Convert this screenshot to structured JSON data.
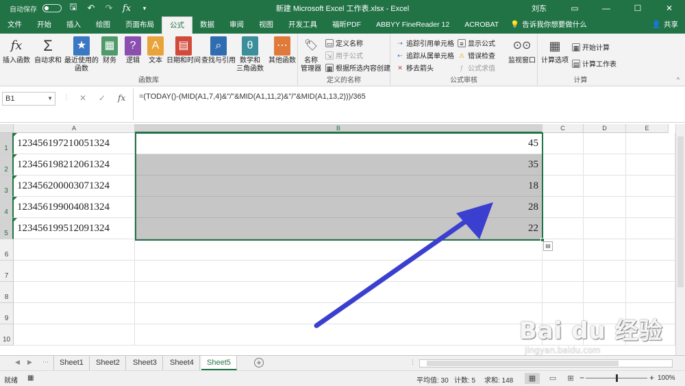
{
  "titlebar": {
    "autosave_label": "自动保存",
    "autosave_state": "关",
    "title": "新建 Microsoft Excel 工作表.xlsx  -  Excel",
    "user": "刘东",
    "min": "—",
    "max": "☐",
    "close": "✕"
  },
  "tabs": [
    "文件",
    "开始",
    "插入",
    "绘图",
    "页面布局",
    "公式",
    "数据",
    "审阅",
    "视图",
    "开发工具",
    "福昕PDF",
    "ABBYY FineReader 12",
    "ACROBAT"
  ],
  "active_tab": "公式",
  "tell_me": "告诉我你想要做什么",
  "share": "共享",
  "ribbon": {
    "function_library": {
      "label": "函数库",
      "buttons": [
        "插入函数",
        "自动求和",
        "最近使用的\n函数",
        "财务",
        "逻辑",
        "文本",
        "日期和时间",
        "查找与引用",
        "数学和\n三角函数",
        "其他函数"
      ]
    },
    "defined_names": {
      "label": "定义的名称",
      "manager": "名称\n管理器",
      "items": [
        "定义名称",
        "用于公式",
        "根据所选内容创建"
      ]
    },
    "formula_auditing": {
      "label": "公式审核",
      "items": [
        "追踪引用单元格",
        "追踪从属单元格",
        "移去箭头",
        "显示公式",
        "错误检查",
        "公式求值"
      ],
      "watch": "监视窗口"
    },
    "calculation": {
      "label": "计算",
      "options": "计算选项",
      "items": [
        "开始计算",
        "计算工作表"
      ]
    }
  },
  "formula_bar": {
    "name_box": "B1",
    "cancel": "✕",
    "enter": "✓",
    "fx": "fx",
    "formula": "=(TODAY()-(MID(A1,7,4)&\"/\"&MID(A1,11,2)&\"/\"&MID(A1,13,2)))/365"
  },
  "columns": [
    "A",
    "B",
    "C",
    "D",
    "E"
  ],
  "rows": [
    "1",
    "2",
    "3",
    "4",
    "5",
    "6",
    "7",
    "8",
    "9",
    "10"
  ],
  "cells": {
    "A": [
      "123456197210051324",
      "123456198212061324",
      "123456200003071324",
      "123456199004081324",
      "123456199512091324"
    ],
    "B": [
      "45",
      "35",
      "18",
      "28",
      "22"
    ]
  },
  "sheets": [
    "Sheet1",
    "Sheet2",
    "Sheet3",
    "Sheet4",
    "Sheet5"
  ],
  "active_sheet": "Sheet5",
  "status": {
    "mode": "就绪",
    "average": "平均值: 30",
    "count": "计数: 5",
    "sum": "求和: 148",
    "zoom": "100%"
  },
  "watermark": {
    "logo": "Bai du 经验",
    "url": "jingyan.baidu.com"
  },
  "colors": {
    "brand": "#217346",
    "arrow": "#3b3fcf"
  }
}
